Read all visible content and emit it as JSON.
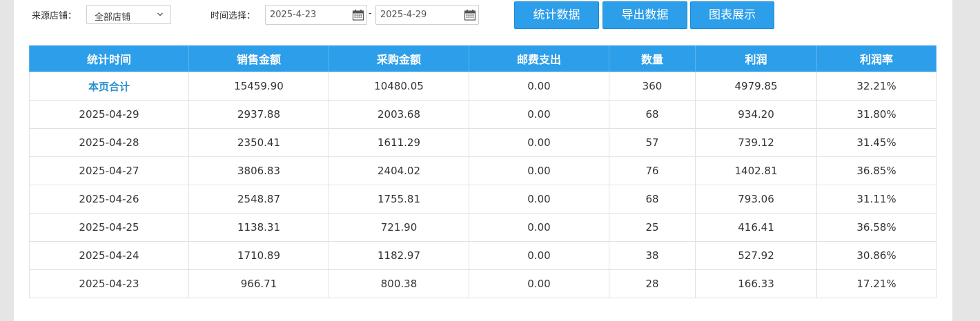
{
  "filters": {
    "source_label": "来源店铺：",
    "source_value": "全部店铺",
    "time_label": "时间选择：",
    "date_from": "2025-4-23",
    "date_separator": "-",
    "date_to": "2025-4-29"
  },
  "buttons": {
    "stats": "统计数据",
    "export": "导出数据",
    "chart": "图表展示"
  },
  "table": {
    "headers": [
      "统计时间",
      "销售金额",
      "采购金额",
      "邮费支出",
      "数量",
      "利润",
      "利润率"
    ],
    "rows": [
      [
        "本页合计",
        "15459.90",
        "10480.05",
        "0.00",
        "360",
        "4979.85",
        "32.21%"
      ],
      [
        "2025-04-29",
        "2937.88",
        "2003.68",
        "0.00",
        "68",
        "934.20",
        "31.80%"
      ],
      [
        "2025-04-28",
        "2350.41",
        "1611.29",
        "0.00",
        "57",
        "739.12",
        "31.45%"
      ],
      [
        "2025-04-27",
        "3806.83",
        "2404.02",
        "0.00",
        "76",
        "1402.81",
        "36.85%"
      ],
      [
        "2025-04-26",
        "2548.87",
        "1755.81",
        "0.00",
        "68",
        "793.06",
        "31.11%"
      ],
      [
        "2025-04-25",
        "1138.31",
        "721.90",
        "0.00",
        "25",
        "416.41",
        "36.58%"
      ],
      [
        "2025-04-24",
        "1710.89",
        "1182.97",
        "0.00",
        "38",
        "527.92",
        "30.86%"
      ],
      [
        "2025-04-23",
        "966.71",
        "800.38",
        "0.00",
        "28",
        "166.33",
        "17.21%"
      ]
    ]
  },
  "colors": {
    "accent": "#2d9ee9",
    "total_text": "#2a8fd0",
    "background": "#e5e5e5"
  },
  "icons": {
    "select": "chevron-down-icon",
    "date": "calendar-icon"
  }
}
